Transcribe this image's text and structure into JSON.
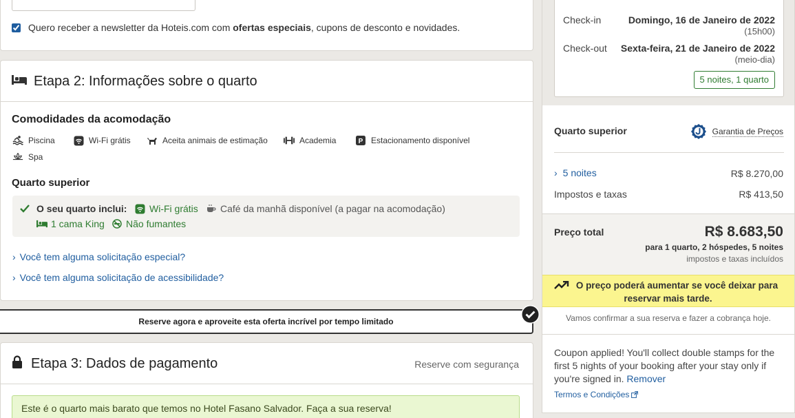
{
  "newsletter": {
    "checked": true,
    "text_prefix": "Quero receber a newsletter da Hoteis.com com ",
    "text_bold": "ofertas especiais",
    "text_suffix": ", cupons de desconto e novidades."
  },
  "step2": {
    "title": "Etapa 2: Informações sobre o quarto",
    "amenities_title": "Comodidades da acomodação",
    "amenities": [
      {
        "label": "Piscina",
        "icon": "pool-icon"
      },
      {
        "label": "Wi-Fi grátis",
        "icon": "wifi-icon"
      },
      {
        "label": "Aceita animais de estimação",
        "icon": "pet-icon"
      },
      {
        "label": "Academia",
        "icon": "gym-icon"
      },
      {
        "label": "Estacionamento disponível",
        "icon": "parking-icon"
      },
      {
        "label": "Spa",
        "icon": "spa-icon"
      }
    ],
    "room_title": "Quarto superior",
    "includes_label": "O seu quarto inclui:",
    "wifi": "Wi-Fi grátis",
    "breakfast": "Café da manhã disponível (a pagar na acomodação)",
    "bed": "1 cama King",
    "nonsmoking": "Não fumantes",
    "special_request": "Você tem alguma solicitação especial?",
    "accessibility_request": "Você tem alguma solicitação de acessibilidade?"
  },
  "banner": {
    "text": "Reserve agora e aproveite esta oferta incrível por tempo limitado"
  },
  "step3": {
    "title": "Etapa 3: Dados de pagamento",
    "secure": "Reserve com segurança",
    "notice": "Este é o quarto mais barato que temos no Hotel Fasano Salvador. Faça a sua reserva!"
  },
  "summary": {
    "checkin_label": "Check-in",
    "checkin_date": "Domingo, 16 de Janeiro de 2022",
    "checkin_time": "(15h00)",
    "checkout_label": "Check-out",
    "checkout_date": "Sexta-feira, 21 de Janeiro de 2022",
    "checkout_time": "(meio-dia)",
    "nights_badge": "5 noites, 1 quarto",
    "room_name": "Quarto superior",
    "guarantee": "Garantia de Preços",
    "nights_link": "5 noites",
    "nights_price": "R$ 8.270,00",
    "taxes_label": "Impostos e taxas",
    "taxes_price": "R$ 413,50",
    "total_label": "Preço total",
    "total_price": "R$ 8.683,50",
    "total_detail": "para 1 quarto, 2 hóspedes, 5 noites",
    "total_note": "impostos e taxas incluídos",
    "price_alert": "O preço poderá aumentar se você deixar para reservar mais tarde.",
    "confirm_note": "Vamos confirmar a sua reserva e fazer a cobrança hoje.",
    "coupon_text": "Coupon applied! You'll collect double stamps for the first 5 nights of your booking after your stay only if you're signed in.",
    "remove": "Remover",
    "terms": "Termos e Condições"
  }
}
